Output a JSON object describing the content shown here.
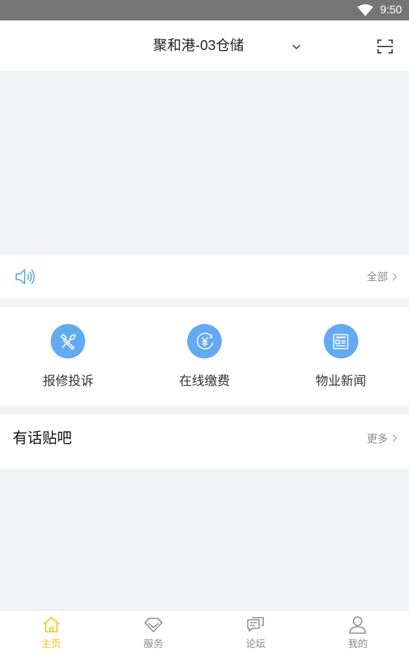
{
  "status_bar": {
    "time": "9:50"
  },
  "header": {
    "title": "聚和港-03仓储"
  },
  "notice": {
    "more_label": "全部"
  },
  "services": [
    {
      "label": "报修投诉",
      "icon": "tools-icon"
    },
    {
      "label": "在线缴费",
      "icon": "yuan-icon"
    },
    {
      "label": "物业新闻",
      "icon": "news-icon"
    }
  ],
  "forum": {
    "title": "有话贴吧",
    "more_label": "更多"
  },
  "tabbar": {
    "active": "主页",
    "tabs": [
      {
        "label": "主页",
        "icon": "home-icon"
      },
      {
        "label": "服务",
        "icon": "diamond-icon"
      },
      {
        "label": "论坛",
        "icon": "chat-icon"
      },
      {
        "label": "我的",
        "icon": "user-icon"
      }
    ]
  },
  "colors": {
    "accent": "#62aaf2",
    "active_tab": "#f2c012",
    "background": "#f1f3f6"
  }
}
